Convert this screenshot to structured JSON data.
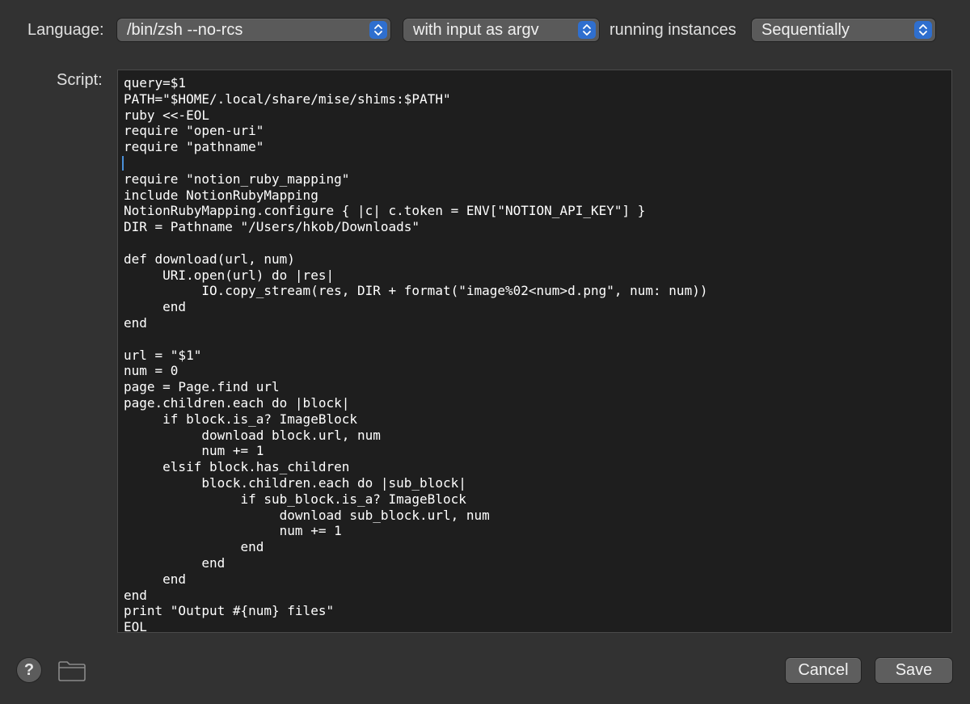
{
  "header": {
    "language_label": "Language:",
    "language_value": "/bin/zsh --no-rcs",
    "input_value": "with input as argv",
    "running_label": "running instances",
    "running_value": "Sequentially"
  },
  "editor": {
    "label": "Script:",
    "code": "query=$1\nPATH=\"$HOME/.local/share/mise/shims:$PATH\"\nruby <<-EOL\nrequire \"open-uri\"\nrequire \"pathname\"\n\nrequire \"notion_ruby_mapping\"\ninclude NotionRubyMapping\nNotionRubyMapping.configure { |c| c.token = ENV[\"NOTION_API_KEY\"] }\nDIR = Pathname \"/Users/hkob/Downloads\"\n\ndef download(url, num)\n     URI.open(url) do |res|\n          IO.copy_stream(res, DIR + format(\"image%02<num>d.png\", num: num))\n     end\nend\n\nurl = \"$1\"\nnum = 0\npage = Page.find url\npage.children.each do |block|\n     if block.is_a? ImageBlock\n          download block.url, num\n          num += 1\n     elsif block.has_children\n          block.children.each do |sub_block|\n               if sub_block.is_a? ImageBlock\n                    download sub_block.url, num\n                    num += 1\n               end\n          end\n     end\nend\nprint \"Output #{num} files\"\nEOL"
  },
  "footer": {
    "help_glyph": "?",
    "cancel_label": "Cancel",
    "save_label": "Save"
  },
  "colors": {
    "window_bg": "#323232",
    "editor_bg": "#1e1e1e",
    "accent": "#2f6fcf"
  }
}
